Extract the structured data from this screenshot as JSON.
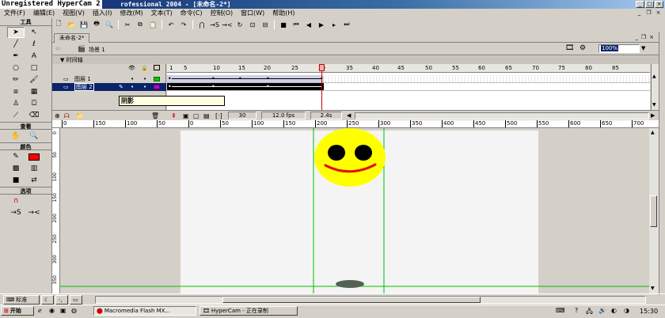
{
  "app": {
    "watermark": "Unregistered HyperCam 2",
    "title": "rofessional 2004 - [未命名-2*]"
  },
  "menu": [
    "文件(F)",
    "编辑(E)",
    "视图(V)",
    "插入(I)",
    "修改(M)",
    "文本(T)",
    "命令(C)",
    "控制(O)",
    "窗口(W)",
    "帮助(H)"
  ],
  "tools_panel": {
    "title": "工具",
    "section_view": "查看",
    "section_colors": "颜色",
    "section_options": "选项",
    "stroke_color": "#000000",
    "fill_color": "#ff0000"
  },
  "document": {
    "tab_label": "未命名-2*",
    "scene_label": "场景 1",
    "zoom_value": "100%"
  },
  "timeline": {
    "header_label": "时间轴",
    "frame_numbers": [
      "1",
      "5",
      "10",
      "15",
      "20",
      "25",
      "30",
      "35",
      "40",
      "45",
      "50",
      "55",
      "60",
      "65",
      "70",
      "75",
      "80",
      "85"
    ],
    "layers": [
      {
        "name": "图层 1",
        "selected": false
      },
      {
        "name": "图层 2",
        "selected": true
      }
    ],
    "tooltip": "阴影",
    "current_frame": "30",
    "fps": "12.0 fps",
    "elapsed": "2.4s"
  },
  "stage_ruler": {
    "h_labels": [
      "0",
      "150",
      "100",
      "50",
      "0",
      "50",
      "100",
      "150",
      "200",
      "250",
      "300",
      "350",
      "400",
      "450",
      "500",
      "550",
      "600",
      "650",
      "700"
    ],
    "v_labels": [
      "0",
      "50",
      "100",
      "150",
      "200",
      "250",
      "300",
      "350"
    ]
  },
  "bottom_panel": {
    "label": "标准"
  },
  "taskbar": {
    "start_label": "开始",
    "items": [
      "Macromedia Flash MX...",
      "HyperCam - 正在录制"
    ],
    "clock": "15:30"
  },
  "colors": {
    "face": "#ffff00",
    "eyes": "#000000",
    "smile": "#e01010",
    "guide": "#00c000",
    "playhead": "#cc0000"
  }
}
